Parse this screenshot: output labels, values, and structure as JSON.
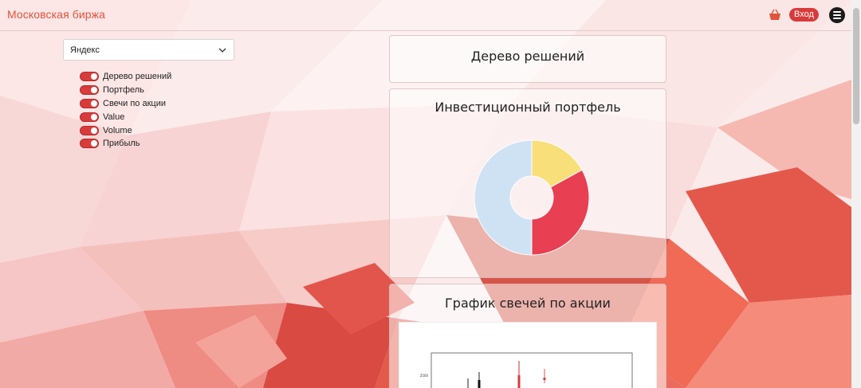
{
  "navbar": {
    "brand": "Московская биржа",
    "cart_icon": "basket-icon",
    "login_label": "Вход",
    "menu_icon": "hamburger-menu-icon",
    "accent_color": "#e0533c"
  },
  "sidebar": {
    "select": {
      "value": "Яндекс"
    },
    "toggles": [
      {
        "label": "Дерево решений",
        "checked": true
      },
      {
        "label": "Портфель",
        "checked": true
      },
      {
        "label": "Свечи по акции",
        "checked": true
      },
      {
        "label": "Value",
        "checked": true
      },
      {
        "label": "Volume",
        "checked": true
      },
      {
        "label": "Прибыль",
        "checked": true
      }
    ]
  },
  "cards": {
    "tree_title": "Дерево решений",
    "portfolio_title": "Инвестиционный портфель",
    "candles_title": "График свечей по акции",
    "candle_tick": "2500"
  },
  "chart_data": {
    "type": "pie",
    "series": [
      {
        "values": [
          17,
          33,
          50
        ],
        "colors": [
          "#f8df7a",
          "#e83f52",
          "#cfe2f3"
        ]
      }
    ]
  }
}
